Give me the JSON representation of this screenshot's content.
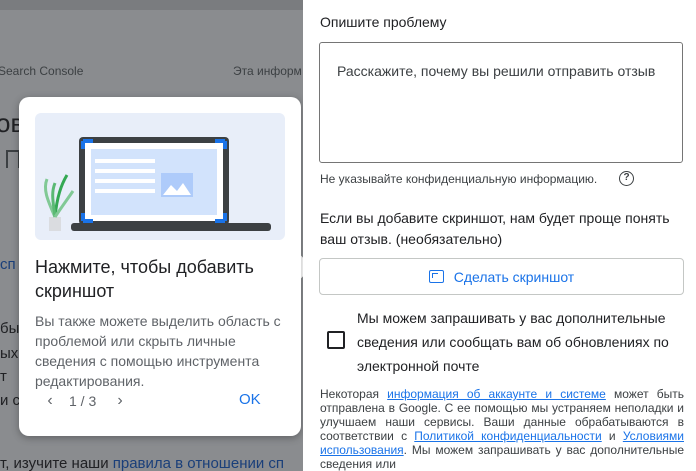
{
  "background_page": {
    "breadcrumb_left": "Search Console",
    "breadcrumb_right": "Эта информ",
    "title_fragment": "ов",
    "link_fragment": "сп",
    "text_fragments": [
      "бы",
      "ых к",
      "т",
      "и с"
    ],
    "bottom_text": "т, изучите наши ",
    "bottom_link": "правила в отношении сп"
  },
  "tip": {
    "title": "Нажмите, чтобы добавить скриншот",
    "body": "Вы также можете выделить область с проблемой или скрыть личные сведения с помощью инструмента редактирования.",
    "counter": "1 / 3",
    "ok_label": "OK",
    "prev_icon": "chevron-left-icon",
    "next_icon": "chevron-right-icon"
  },
  "panel": {
    "describe_label": "Опишите проблему",
    "textarea_placeholder": "Расскажите, почему вы решили отправить отзыв",
    "hint": "Не указывайте конфиденциальную информацию.",
    "screenshot_text": "Если вы добавите скриншот, нам будет проще понять ваш отзыв. (необязательно)",
    "screenshot_button": "Сделать скриншот",
    "consent_text": "Мы можем запрашивать у вас дополнительные сведения или сообщать вам об обновлениях по электронной почте",
    "legal": {
      "p1": "Некоторая ",
      "link1": "информация об аккаунте и системе",
      "p2": " может быть отправлена в Google. С ее помощью мы устраняем неполадки и улучшаем наши сервисы. Ваши данные обрабатываются в соответствии с ",
      "link2": "Политикой конфиденциальности",
      "p3": " и ",
      "link3": "Условиями использования",
      "p4": ". Мы можем запрашивать у вас дополнительные сведения или"
    }
  },
  "colors": {
    "accent": "#1a73e8",
    "overlay": "#8a8c8f",
    "text": "#202124"
  }
}
